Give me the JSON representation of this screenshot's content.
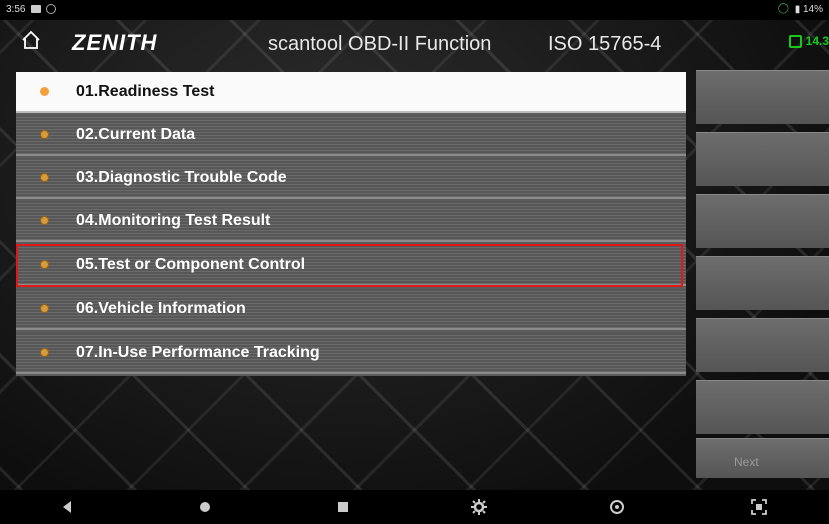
{
  "status_bar": {
    "time": "3:56",
    "battery": "14%"
  },
  "header": {
    "logo": "ZENITH",
    "title": "scantool OBD-II Function",
    "protocol": "ISO 15765-4",
    "voltage": "14.3"
  },
  "menu": {
    "items": [
      {
        "label": "01.Readiness Test"
      },
      {
        "label": "02.Current Data"
      },
      {
        "label": "03.Diagnostic Trouble Code"
      },
      {
        "label": "04.Monitoring Test Result"
      },
      {
        "label": "05.Test or Component Control"
      },
      {
        "label": "06.Vehicle Information"
      },
      {
        "label": "07.In-Use Performance Tracking"
      }
    ],
    "selected_index": 0,
    "highlighted_index": 4
  },
  "side_panel": {
    "button_count": 6,
    "bottom_label": "Next"
  },
  "nav_bar": {
    "icons": [
      "back-icon",
      "home-circle-icon",
      "recents-icon",
      "settings-gear-icon",
      "power-icon",
      "screenshot-icon"
    ]
  },
  "colors": {
    "highlight": "#e01818",
    "voltage": "#19c919",
    "bullet": "#d89b3a"
  }
}
